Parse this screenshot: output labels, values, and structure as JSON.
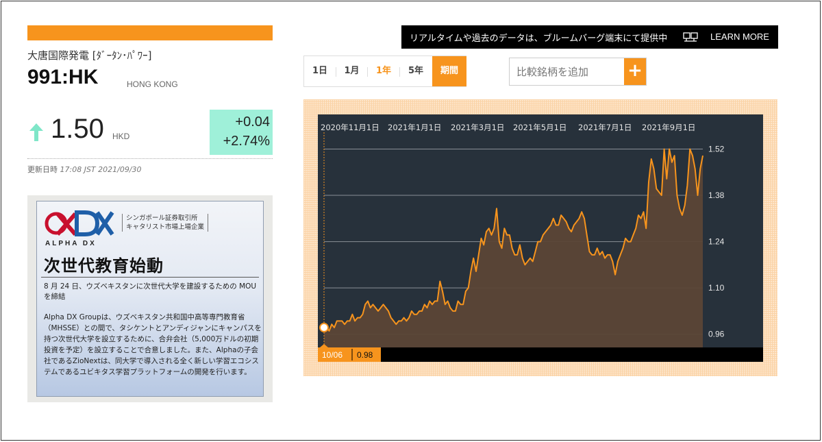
{
  "quote": {
    "company_name": "大唐国際発電 [ﾀﾞｰﾀﾝ･ﾊﾟﾜｰ]",
    "ticker": "991:HK",
    "exchange": "HONG KONG",
    "price": "1.50",
    "currency": "HKD",
    "change_abs": "+0.04",
    "change_pct": "+2.74%",
    "updated_label": "更新日時",
    "updated_value": "17:08 JST 2021/09/30",
    "direction": "up"
  },
  "ad": {
    "logo_text": "ALPHA DX",
    "sub_line1": "シンガポール証券取引所",
    "sub_line2": "キャタリスト市場上場企業",
    "headline": "次世代教育始動",
    "para1": "8 月 24 日、ウズベキスタンに次世代大学を建設するための MOU を締結",
    "para2": "Alpha DX Groupは、ウズベキスタン共和国中高等専門教育省（MHSSE）との間で、タシケントとアンディジャンにキャンパスを持つ次世代大学を設立するために、合弁会社（5,000万ドルの初期投資を予定）を設立することで合意しました。また、Alphaの子会社であるZioNextは、同大学で導入される全く新しい学習エコシステムであるユビキタス学習プラットフォームの開発を行います。"
  },
  "banner": {
    "text": "リアルタイムや過去のデータは、ブルームバーグ端末にて提供中",
    "icon": "terminal-icon",
    "cta": "LEARN MORE"
  },
  "range_tabs": [
    {
      "label": "1日",
      "active": false
    },
    {
      "label": "1月",
      "active": false
    },
    {
      "label": "1年",
      "active": true
    },
    {
      "label": "5年",
      "active": false
    },
    {
      "label": "期間",
      "active": false
    }
  ],
  "compare": {
    "placeholder": "比較銘柄を追加",
    "button": "+"
  },
  "colors": {
    "accent": "#f7941d",
    "chart_bg": "#27313b",
    "change_bg": "#9ff0d9",
    "up_arrow": "#7fe6c8"
  },
  "chart_data": {
    "type": "area",
    "x_start": "2020/10/06",
    "x_end": "2021/09/30",
    "x_ticks": [
      "2020年11月1日",
      "2021年1月1日",
      "2021年3月1日",
      "2021年5月1日",
      "2021年7月1日",
      "2021年9月1日"
    ],
    "y_ticks": [
      "1.52",
      "1.38",
      "1.24",
      "1.10",
      "0.96"
    ],
    "ylim": [
      0.92,
      1.55
    ],
    "grid": true,
    "crosshair": {
      "date_label": "10/06",
      "value_label": "0.98"
    },
    "values": [
      0.98,
      0.98,
      0.97,
      0.99,
      0.98,
      1.0,
      1.0,
      1.0,
      0.99,
      1.0,
      1.0,
      1.02,
      1.0,
      1.01,
      1.01,
      1.02,
      1.05,
      1.06,
      1.04,
      1.05,
      1.04,
      1.03,
      1.04,
      1.05,
      1.04,
      1.03,
      1.01,
      1.0,
      0.99,
      1.0,
      1.0,
      1.01,
      1.0,
      1.01,
      1.03,
      1.02,
      1.02,
      1.03,
      1.03,
      1.05,
      1.04,
      1.06,
      1.05,
      1.06,
      1.06,
      1.12,
      1.09,
      1.05,
      1.06,
      1.04,
      1.03,
      1.03,
      1.06,
      1.05,
      1.05,
      1.09,
      1.1,
      1.15,
      1.19,
      1.15,
      1.2,
      1.25,
      1.23,
      1.27,
      1.28,
      1.26,
      1.28,
      1.34,
      1.24,
      1.22,
      1.28,
      1.26,
      1.26,
      1.22,
      1.2,
      1.2,
      1.23,
      1.19,
      1.17,
      1.18,
      1.19,
      1.18,
      1.21,
      1.24,
      1.24,
      1.26,
      1.27,
      1.28,
      1.29,
      1.31,
      1.29,
      1.29,
      1.32,
      1.31,
      1.3,
      1.28,
      1.27,
      1.29,
      1.3,
      1.31,
      1.33,
      1.31,
      1.26,
      1.21,
      1.2,
      1.2,
      1.22,
      1.2,
      1.21,
      1.19,
      1.2,
      1.2,
      1.18,
      1.14,
      1.18,
      1.2,
      1.22,
      1.25,
      1.24,
      1.24,
      1.26,
      1.28,
      1.32,
      1.31,
      1.33,
      1.28,
      1.42,
      1.49,
      1.46,
      1.4,
      1.39,
      1.38,
      1.52,
      1.43,
      1.52,
      1.48,
      1.5,
      1.38,
      1.34,
      1.32,
      1.35,
      1.41,
      1.52,
      1.5,
      1.46,
      1.38,
      1.46,
      1.5
    ]
  }
}
